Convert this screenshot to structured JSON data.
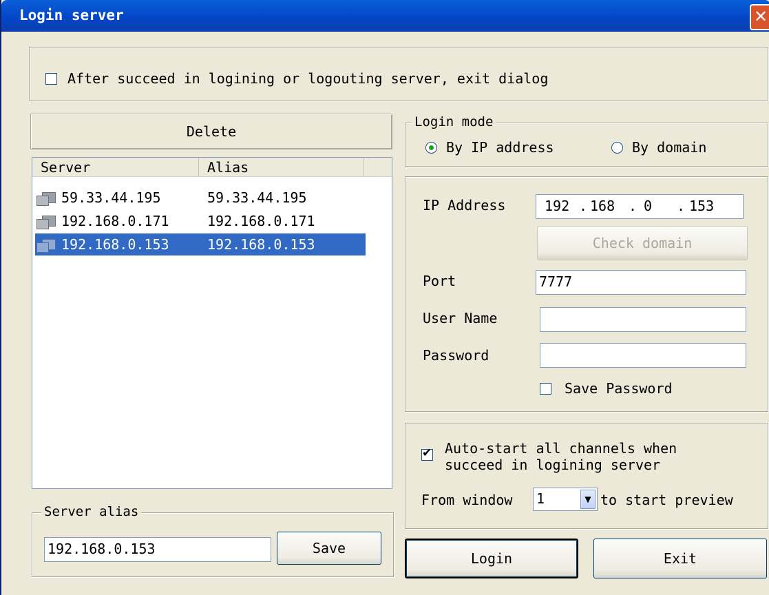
{
  "window": {
    "title": "Login server",
    "close_icon": "close-icon"
  },
  "options": {
    "exit_after_label": "After succeed in logining or logouting server, exit dialog",
    "exit_after_checked": false
  },
  "server_list": {
    "delete_label": "Delete",
    "columns": [
      "Server",
      "Alias"
    ],
    "rows": [
      {
        "server": "59.33.44.195",
        "alias": "59.33.44.195",
        "selected": false
      },
      {
        "server": "192.168.0.171",
        "alias": "192.168.0.171",
        "selected": false
      },
      {
        "server": "192.168.0.153",
        "alias": "192.168.0.153",
        "selected": true
      }
    ]
  },
  "server_alias": {
    "legend": "Server alias",
    "value": "192.168.0.153",
    "save_label": "Save"
  },
  "login_mode": {
    "legend": "Login mode",
    "by_ip_label": "By IP address",
    "by_domain_label": "By domain",
    "selected": "ip"
  },
  "connection": {
    "ip_label": "IP Address",
    "ip_octets": [
      "192",
      "168",
      "0",
      "153"
    ],
    "check_domain_label": "Check domain",
    "port_label": "Port",
    "port_value": "7777",
    "user_label": "User Name",
    "user_value": "",
    "password_label": "Password",
    "password_value": "",
    "save_password_label": "Save Password",
    "save_password_checked": false
  },
  "preview": {
    "autostart_label_line1": "Auto-start all channels when",
    "autostart_label_line2": "succeed in logining server",
    "autostart_checked": true,
    "from_window_label": "From window",
    "window_value": "1",
    "to_start_label": "to start preview"
  },
  "actions": {
    "login_label": "Login",
    "exit_label": "Exit"
  }
}
